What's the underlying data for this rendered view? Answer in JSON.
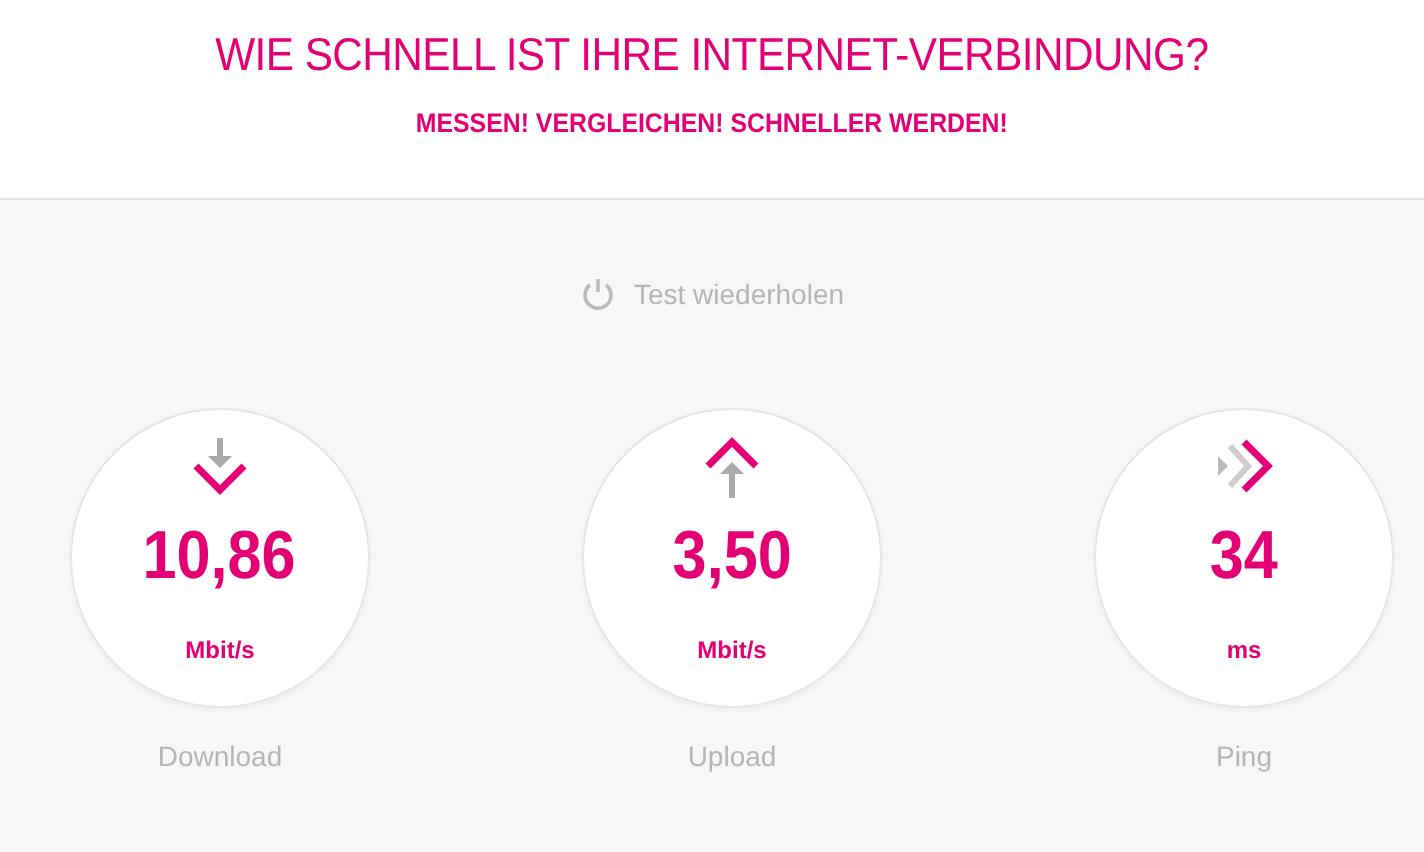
{
  "header": {
    "title": "WIE SCHNELL IST IHRE INTERNET-VERBINDUNG?",
    "subtitle": "MESSEN! VERGLEICHEN! SCHNELLER WERDEN!"
  },
  "repeat_button": {
    "label": "Test wiederholen"
  },
  "results": [
    {
      "kind": "download",
      "value": "10,86",
      "unit": "Mbit/s",
      "label": "Download"
    },
    {
      "kind": "upload",
      "value": "3,50",
      "unit": "Mbit/s",
      "label": "Upload"
    },
    {
      "kind": "ping",
      "value": "34",
      "unit": "ms",
      "label": "Ping"
    }
  ]
}
